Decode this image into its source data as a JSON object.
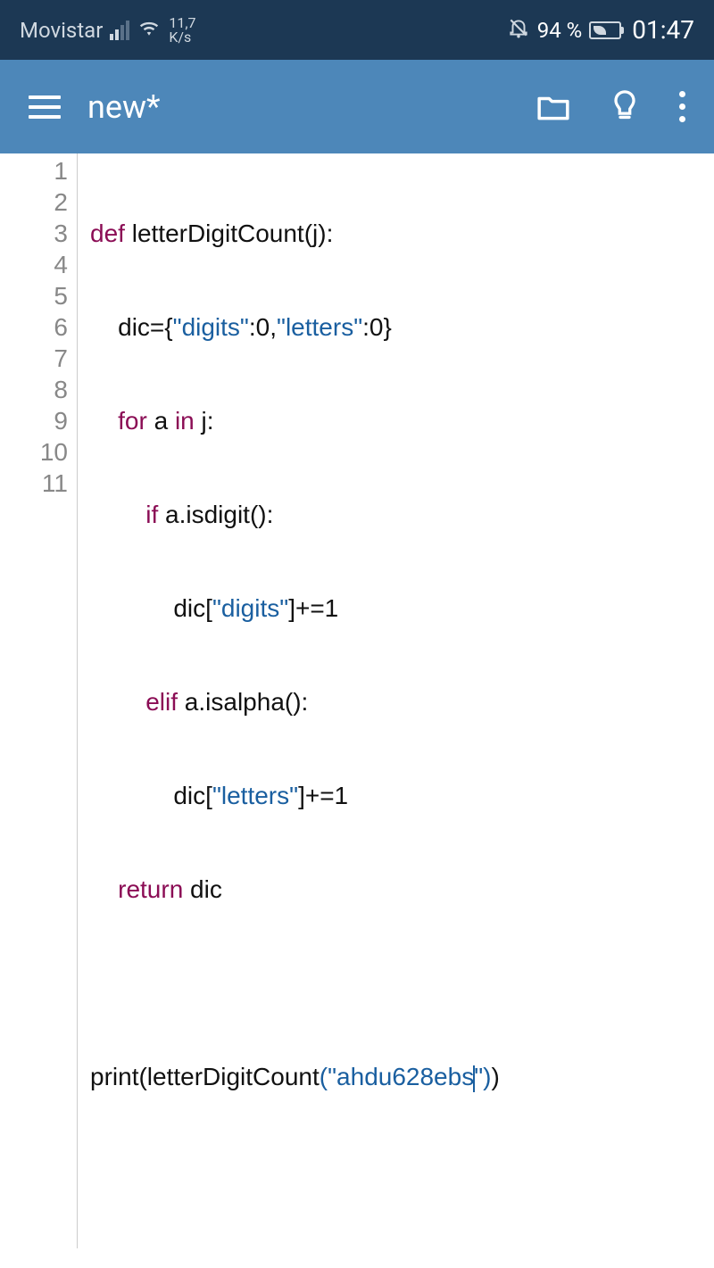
{
  "status_bar": {
    "carrier": "Movistar",
    "data_speed_top": "11,7",
    "data_speed_bottom": "K/s",
    "battery_pct": "94 %",
    "time": "01:47"
  },
  "app_bar": {
    "title": "new*"
  },
  "editor": {
    "line_numbers": [
      "1",
      "2",
      "3",
      "4",
      "5",
      "6",
      "7",
      "8",
      "9",
      "10",
      "11"
    ],
    "line1": {
      "t1": "def",
      "t2": " letterDigitCount(j):"
    },
    "line2": {
      "t1": "    dic={",
      "t2": "\"digits\"",
      "t3": ":0,",
      "t4": "\"letters\"",
      "t5": ":0}"
    },
    "line3": {
      "t1": "    ",
      "t2": "for",
      "t3": " a ",
      "t4": "in",
      "t5": " j:"
    },
    "line4": {
      "t1": "        ",
      "t2": "if",
      "t3": " a.isdigit():"
    },
    "line5": {
      "t1": "            dic[",
      "t2": "\"digits\"",
      "t3": "]+=1"
    },
    "line6": {
      "t1": "        ",
      "t2": "elif",
      "t3": " a.isalpha():"
    },
    "line7": {
      "t1": "            dic[",
      "t2": "\"letters\"",
      "t3": "]+=1"
    },
    "line8": {
      "t1": "    ",
      "t2": "return",
      "t3": " dic"
    },
    "line10": {
      "t1": "print(letterDigitCount",
      "t2": "(",
      "t3": "\"ahdu628ebs",
      "t4": "\"",
      "t5": ")",
      "t6": ")"
    }
  }
}
